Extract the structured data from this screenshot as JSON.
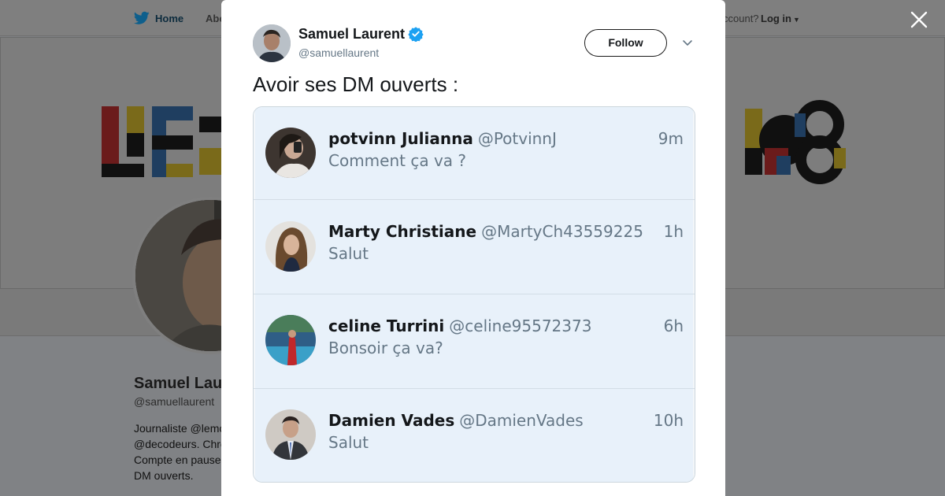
{
  "background": {
    "nav": {
      "home_label": "Home",
      "about_label": "Abo",
      "account_text": "ccount?",
      "login_label": "Log in"
    },
    "profile": {
      "name": "Samuel Lau",
      "handle": "@samuellaurent",
      "bio_lines": [
        "Journaliste @lemo",
        "@decodeurs. Chro",
        "Compte en pause",
        "DM ouverts."
      ]
    }
  },
  "modal": {
    "author": {
      "name": "Samuel Laurent",
      "handle": "@samuellaurent",
      "verified": true
    },
    "follow_label": "Follow",
    "tweet_text": "Avoir ses DM ouverts :",
    "dm_list": [
      {
        "name": "potvinn Julianna",
        "handle": "@PotvinnJ",
        "time": "9m",
        "message": "Comment ça va ?"
      },
      {
        "name": "Marty Christiane",
        "handle": "@MartyCh43559225",
        "time": "1h",
        "message": "Salut"
      },
      {
        "name": "celine Turrini",
        "handle": "@celine95572373",
        "time": "6h",
        "message": "Bonsoir ça va?"
      },
      {
        "name": "Damien Vades",
        "handle": "@DamienVades",
        "time": "10h",
        "message": "Salut"
      }
    ]
  },
  "colors": {
    "accent": "#1da1f2",
    "overlay": "#808285",
    "dm_background": "#e8f1fa",
    "text_secondary": "#657786"
  },
  "icons": [
    "twitter-bird-icon",
    "close-icon",
    "verified-badge-icon",
    "chevron-down-icon",
    "caret-down-icon"
  ]
}
